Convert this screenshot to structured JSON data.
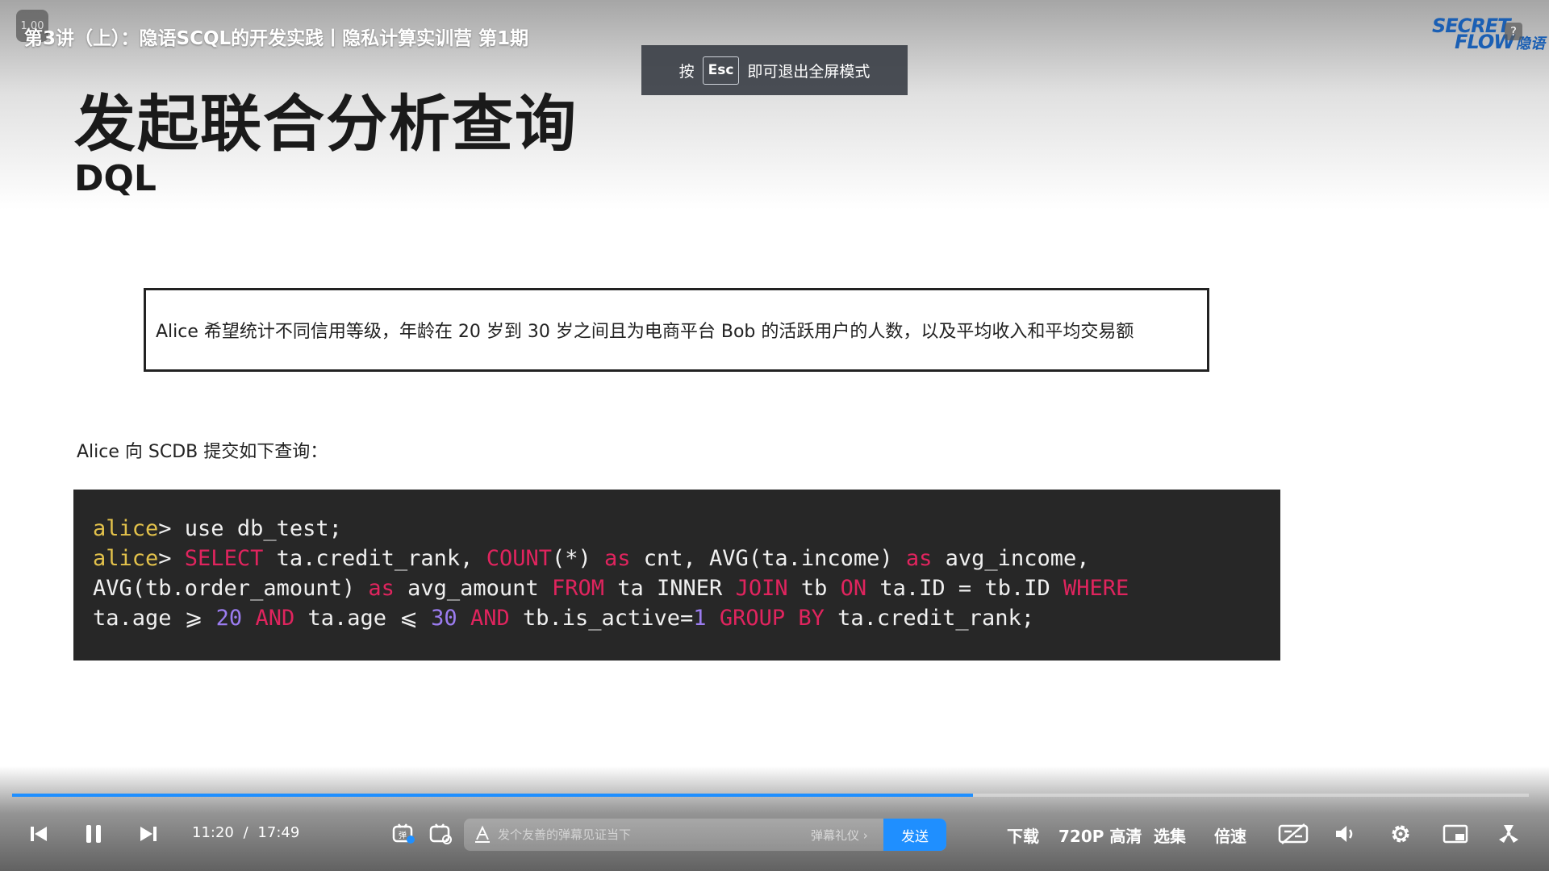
{
  "overlay": {
    "speed_badge": "1.00",
    "video_title": "第3讲（上）：隐语SCQL的开发实践丨隐私计算实训营 第1期",
    "logo_line1": "SECRET",
    "logo_line2": "FLOW",
    "logo_cn": "隐语",
    "help_glyph": "?"
  },
  "esc_toast": {
    "prefix": "按",
    "key": "Esc",
    "suffix": "即可退出全屏模式"
  },
  "slide": {
    "title": "发起联合分析查询",
    "subtitle": "DQL",
    "question": "Alice 希望统计不同信用等级，年龄在 20 岁到 30 岁之间且为电商平台 Bob 的活跃用户的人数，以及平均收入和平均交易额",
    "submit_label": "Alice 向 SCDB 提交如下查询：",
    "code_lines": [
      [
        {
          "t": "alice",
          "c": "prompt"
        },
        {
          "t": "> use db_test;",
          "c": "plain"
        }
      ],
      [
        {
          "t": "alice",
          "c": "prompt"
        },
        {
          "t": "> ",
          "c": "plain"
        },
        {
          "t": "SELECT",
          "c": "kw"
        },
        {
          "t": " ta.credit_rank, ",
          "c": "plain"
        },
        {
          "t": "COUNT",
          "c": "kw"
        },
        {
          "t": "(*) ",
          "c": "plain"
        },
        {
          "t": "as",
          "c": "kw"
        },
        {
          "t": " cnt, AVG(ta.income) ",
          "c": "plain"
        },
        {
          "t": "as",
          "c": "kw"
        },
        {
          "t": " avg_income,",
          "c": "plain"
        }
      ],
      [
        {
          "t": "AVG(tb.order_amount) ",
          "c": "plain"
        },
        {
          "t": "as",
          "c": "kw"
        },
        {
          "t": " avg_amount ",
          "c": "plain"
        },
        {
          "t": "FROM",
          "c": "kw"
        },
        {
          "t": " ta INNER ",
          "c": "plain"
        },
        {
          "t": "JOIN",
          "c": "kw"
        },
        {
          "t": " tb ",
          "c": "plain"
        },
        {
          "t": "ON",
          "c": "kw"
        },
        {
          "t": " ta.ID = tb.ID ",
          "c": "plain"
        },
        {
          "t": "WHERE",
          "c": "kw"
        }
      ],
      [
        {
          "t": "ta.age ⩾ ",
          "c": "plain"
        },
        {
          "t": "20",
          "c": "num"
        },
        {
          "t": " ",
          "c": "plain"
        },
        {
          "t": "AND",
          "c": "kw"
        },
        {
          "t": " ta.age ⩽ ",
          "c": "plain"
        },
        {
          "t": "30",
          "c": "num"
        },
        {
          "t": " ",
          "c": "plain"
        },
        {
          "t": "AND",
          "c": "kw"
        },
        {
          "t": " tb.is_active=",
          "c": "plain"
        },
        {
          "t": "1",
          "c": "num"
        },
        {
          "t": " ",
          "c": "plain"
        },
        {
          "t": "GROUP BY",
          "c": "kw"
        },
        {
          "t": " ta.credit_rank;",
          "c": "plain"
        }
      ]
    ]
  },
  "player": {
    "current_time": "11:20",
    "separator": "/",
    "total_time": "17:49",
    "progress_fraction": 0.6335,
    "buffered_fraction": 0.575,
    "danmaku_placeholder": "发个友善的弹幕见证当下",
    "danmaku_gift": "弹幕礼仪 ›",
    "send_label": "发送",
    "menu": {
      "download": "下载",
      "quality": "720P 高清",
      "episodes": "选集",
      "speed": "倍速"
    },
    "colors": {
      "accent": "#1f8fff",
      "keyword": "#e0245e",
      "prompt": "#e3c24b",
      "number": "#9b7cf0"
    }
  }
}
